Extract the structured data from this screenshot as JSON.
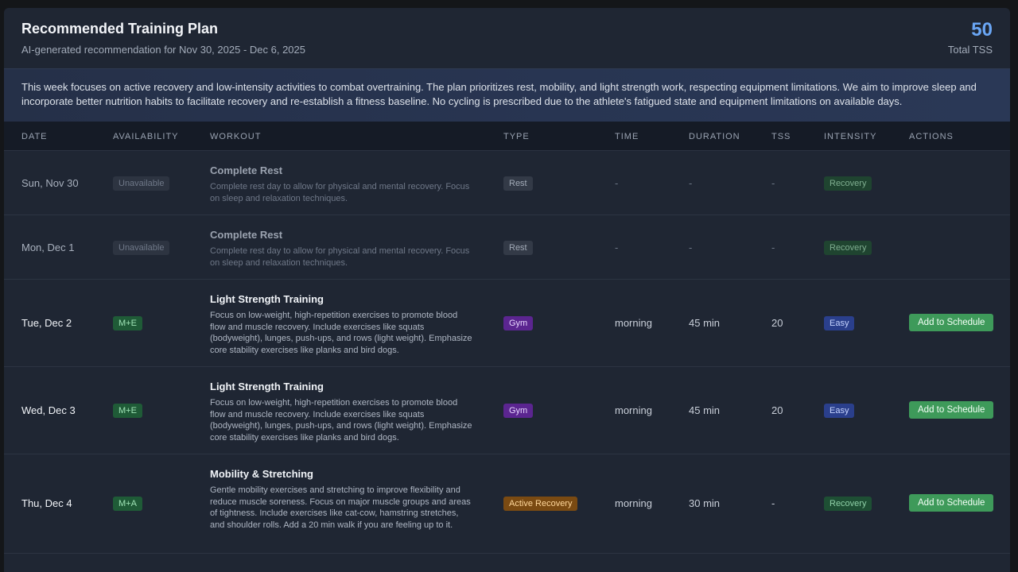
{
  "header": {
    "title": "Recommended Training Plan",
    "subtitle": "AI-generated recommendation for Nov 30, 2025 - Dec 6, 2025",
    "total_tss_value": "50",
    "total_tss_label": "Total TSS"
  },
  "summary": "This week focuses on active recovery and low-intensity activities to combat overtraining. The plan prioritizes rest, mobility, and light strength work, respecting equipment limitations. We aim to improve sleep and incorporate better nutrition habits to facilitate recovery and re-establish a fitness baseline. No cycling is prescribed due to the athlete's fatigued state and equipment limitations on available days.",
  "columns": {
    "date": "DATE",
    "availability": "AVAILABILITY",
    "workout": "WORKOUT",
    "type": "TYPE",
    "time": "TIME",
    "duration": "DURATION",
    "tss": "TSS",
    "intensity": "INTENSITY",
    "actions": "ACTIONS"
  },
  "rows": [
    {
      "date": "Sun, Nov 30",
      "availability": "Unavailable",
      "workout_title": "Complete Rest",
      "workout_desc": "Complete rest day to allow for physical and mental recovery. Focus on sleep and relaxation techniques.",
      "type": "Rest",
      "time": "-",
      "duration": "-",
      "tss": "-",
      "intensity": "Recovery"
    },
    {
      "date": "Mon, Dec 1",
      "availability": "Unavailable",
      "workout_title": "Complete Rest",
      "workout_desc": "Complete rest day to allow for physical and mental recovery. Focus on sleep and relaxation techniques.",
      "type": "Rest",
      "time": "-",
      "duration": "-",
      "tss": "-",
      "intensity": "Recovery"
    },
    {
      "date": "Tue, Dec 2",
      "availability": "M+E",
      "workout_title": "Light Strength Training",
      "workout_desc": "Focus on low-weight, high-repetition exercises to promote blood flow and muscle recovery. Include exercises like squats (bodyweight), lunges, push-ups, and rows (light weight). Emphasize core stability exercises like planks and bird dogs.",
      "type": "Gym",
      "time": "morning",
      "duration": "45 min",
      "tss": "20",
      "intensity": "Easy",
      "action": "Add to Schedule"
    },
    {
      "date": "Wed, Dec 3",
      "availability": "M+E",
      "workout_title": "Light Strength Training",
      "workout_desc": "Focus on low-weight, high-repetition exercises to promote blood flow and muscle recovery. Include exercises like squats (bodyweight), lunges, push-ups, and rows (light weight). Emphasize core stability exercises like planks and bird dogs.",
      "type": "Gym",
      "time": "morning",
      "duration": "45 min",
      "tss": "20",
      "intensity": "Easy",
      "action": "Add to Schedule"
    },
    {
      "date": "Thu, Dec 4",
      "availability": "M+A",
      "workout_title": "Mobility & Stretching",
      "workout_desc": "Gentle mobility exercises and stretching to improve flexibility and reduce muscle soreness. Focus on major muscle groups and areas of tightness. Include exercises like cat-cow, hamstring stretches, and shoulder rolls. Add a 20 min walk if you are feeling up to it.",
      "type": "Active Recovery",
      "time": "morning",
      "duration": "30 min",
      "tss": "-",
      "intensity": "Recovery",
      "action": "Add to Schedule"
    }
  ],
  "colors": {
    "accent_blue": "#6aa6f5",
    "button_green": "#3e9a5a",
    "gym_purple": "#5b2590",
    "active_recovery_orange": "#7a4a12",
    "easy_blue": "#2a3f8c",
    "recovery_green": "#1e4f34"
  }
}
